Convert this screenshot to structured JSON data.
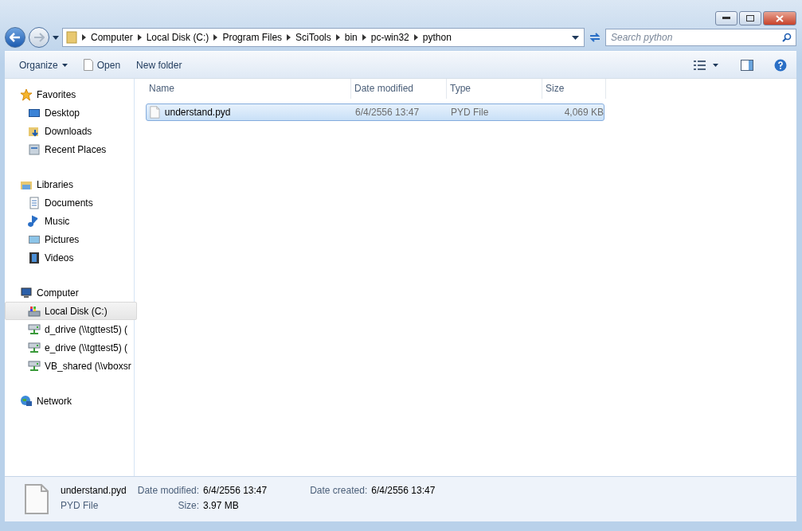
{
  "breadcrumb": [
    "Computer",
    "Local Disk (C:)",
    "Program Files",
    "SciTools",
    "bin",
    "pc-win32",
    "python"
  ],
  "search": {
    "placeholder": "Search python"
  },
  "toolbar": {
    "organize": "Organize",
    "open": "Open",
    "new_folder": "New folder"
  },
  "nav": [
    {
      "label": "Favorites",
      "kind": "star",
      "selected": false,
      "children": [
        {
          "label": "Desktop",
          "kind": "desktop",
          "selected": false
        },
        {
          "label": "Downloads",
          "kind": "downloads",
          "selected": false
        },
        {
          "label": "Recent Places",
          "kind": "recent",
          "selected": false
        }
      ]
    },
    {
      "label": "Libraries",
      "kind": "library",
      "selected": false,
      "children": [
        {
          "label": "Documents",
          "kind": "document",
          "selected": false
        },
        {
          "label": "Music",
          "kind": "music",
          "selected": false
        },
        {
          "label": "Pictures",
          "kind": "picture",
          "selected": false
        },
        {
          "label": "Videos",
          "kind": "video",
          "selected": false
        }
      ]
    },
    {
      "label": "Computer",
      "kind": "computer",
      "selected": false,
      "children": [
        {
          "label": "Local Disk (C:)",
          "kind": "disk",
          "selected": true
        },
        {
          "label": "d_drive (\\\\tgttest5) (",
          "kind": "netdrive",
          "selected": false
        },
        {
          "label": "e_drive (\\\\tgttest5) (",
          "kind": "netdrive",
          "selected": false
        },
        {
          "label": "VB_shared (\\\\vboxsr",
          "kind": "netdrive",
          "selected": false
        }
      ]
    },
    {
      "label": "Network",
      "kind": "network",
      "selected": false
    }
  ],
  "table": {
    "columns": [
      "Name",
      "Date modified",
      "Type",
      "Size"
    ],
    "rows": [
      {
        "name": "understand.pyd",
        "date": "6/4/2556 13:47",
        "type": "PYD File",
        "size": "4,069 KB",
        "selected": true
      }
    ]
  },
  "details": {
    "name": "understand.pyd",
    "type": "PYD File",
    "modified_label": "Date modified:",
    "modified": "6/4/2556 13:47",
    "size_label": "Size:",
    "size": "3.97 MB",
    "created_label": "Date created:",
    "created": "6/4/2556 13:47"
  }
}
